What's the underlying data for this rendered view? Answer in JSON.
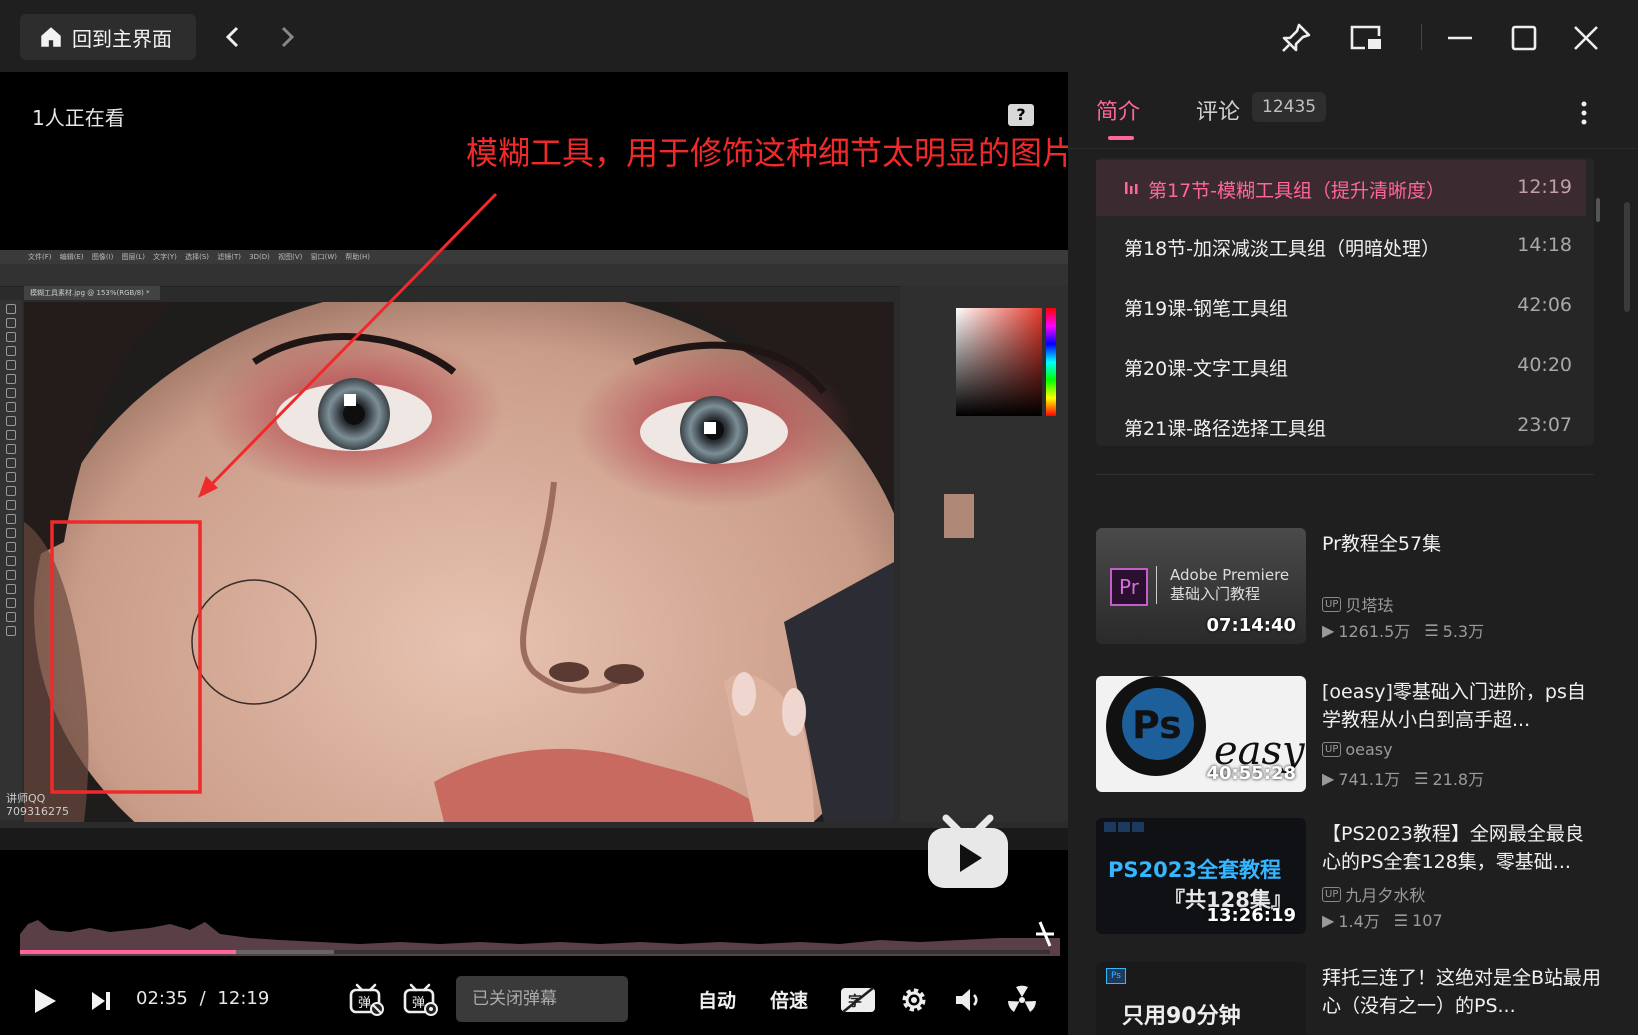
{
  "topbar": {
    "home_label": "回到主界面"
  },
  "player": {
    "watching": "1人正在看",
    "help": "?",
    "annotation": "模糊工具，用于修饰这种细节太明显的图片",
    "ps_menu": "文件(F) 编辑(E) 图像(I) 图层(L) 文字(Y) 选择(S) 滤镜(T) 3D(D) 视图(V) 窗口(W) 帮助(H)",
    "ps_tab": "模糊工具素材.jpg @ 153%(RGB/8) *",
    "lecturer": "讲师QQ\n709316275",
    "time_current": "02:35",
    "time_sep": "/",
    "time_total": "12:19",
    "progress_fraction": 0.21,
    "buffer_fraction": 0.305,
    "danmaku_placeholder": "已关闭弹幕",
    "quality_label": "自动",
    "speed_label": "倍速"
  },
  "sidebar": {
    "tab_intro": "简介",
    "tab_comment": "评论",
    "comment_count": "12435",
    "episodes": [
      {
        "title": "第17节-模糊工具组（提升清晰度）",
        "duration": "12:19",
        "active": true
      },
      {
        "title": "第18节-加深减淡工具组（明暗处理）",
        "duration": "14:18"
      },
      {
        "title": "第19课-钢笔工具组",
        "duration": "42:06"
      },
      {
        "title": "第20课-文字工具组",
        "duration": "40:20"
      },
      {
        "title": "第21课-路径选择工具组",
        "duration": "23:07"
      }
    ],
    "recommendations": [
      {
        "title": "Pr教程全57集",
        "up": "贝塔珐",
        "views": "1261.5万",
        "comments": "5.3万",
        "duration": "07:14:40",
        "thumb_line1": "Adobe Premiere",
        "thumb_line2": "基础入门教程",
        "thumb_logo": "Pr"
      },
      {
        "title": "[oeasy]零基础入门进阶，ps自学教程从小白到高手超...",
        "up": "oeasy",
        "views": "741.1万",
        "comments": "21.8万",
        "duration": "40:55:28",
        "thumb_logo": "Ps",
        "thumb_word": "easy"
      },
      {
        "title": "【PS2023教程】全网最全最良心的PS全套128集，零基础...",
        "up": "九月夕水秋",
        "views": "1.4万",
        "comments": "107",
        "duration": "13:26:19",
        "thumb_line1": "PS2023全套教程",
        "thumb_line2": "『共128集』"
      },
      {
        "title": "拜托三连了！这绝对是全B站最用心（没有之一）的PS...",
        "thumb_line1": "只用90分钟"
      }
    ]
  },
  "colors": {
    "accent": "#ff6699",
    "annotation": "#f02a2a",
    "bg": "#1f1f1f"
  }
}
